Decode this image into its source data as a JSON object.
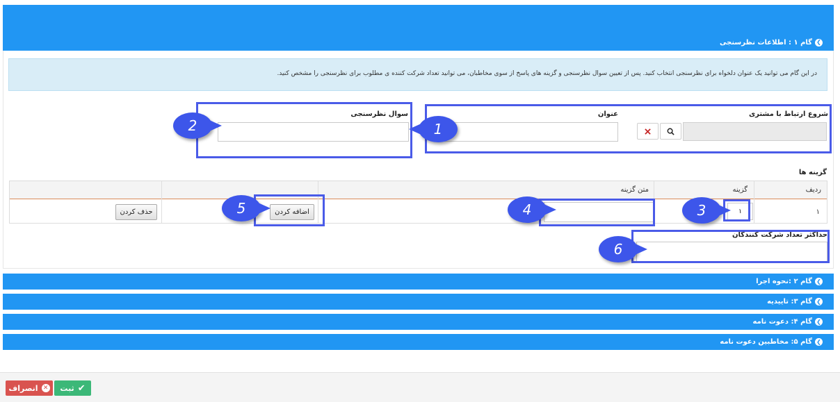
{
  "step1": {
    "title": "گام ۱ : اطلاعات نظرسنجی",
    "info_text": "در این گام می توانید یک عنوان دلخواه برای نظرسنجی انتخاب کنید. پس از تعیین سوال نظرسنجی و گزینه های پاسخ از سوی مخاطبان، می توانید تعداد شرکت کننده ی مطلوب برای نظرسنجی را مشخص کنید.",
    "customer_label": "شروع ارتباط با مشتری",
    "customer_value": "",
    "title_label": "عنوان",
    "title_value": "",
    "question_label": "سوال نظرسنجی",
    "question_value": "",
    "options_heading": "گزینه ها",
    "table": {
      "headers": [
        "ردیف",
        "گزینه",
        "متن گزینه",
        ""
      ],
      "rows": [
        {
          "row": "۱",
          "option": "۱",
          "text": ""
        }
      ],
      "add_label": "اضافه کردن",
      "delete_label": "حذف کردن"
    },
    "max_label": "حداکثر تعداد شرکت کنندگان",
    "max_value": ""
  },
  "steps": [
    {
      "title": "گام ۲ :نحوه اجرا"
    },
    {
      "title": "گام ۳: تاییدیه"
    },
    {
      "title": "گام ۴: دعوت نامه"
    },
    {
      "title": "گام ۵: مخاطبین دعوت نامه"
    }
  ],
  "callouts": [
    "1",
    "2",
    "3",
    "4",
    "5",
    "6"
  ],
  "footer": {
    "save_label": "ثبت",
    "cancel_label": "انصراف"
  },
  "colors": {
    "primary_blue": "#2196F3",
    "callout_blue": "#3d56ea",
    "info_bg": "#d9edf7",
    "save_green": "#3cb878",
    "cancel_red": "#d9534f"
  },
  "icons": [
    "chevron-circle-icon",
    "search-icon",
    "close-icon",
    "check-icon",
    "cancel-circle-icon"
  ]
}
